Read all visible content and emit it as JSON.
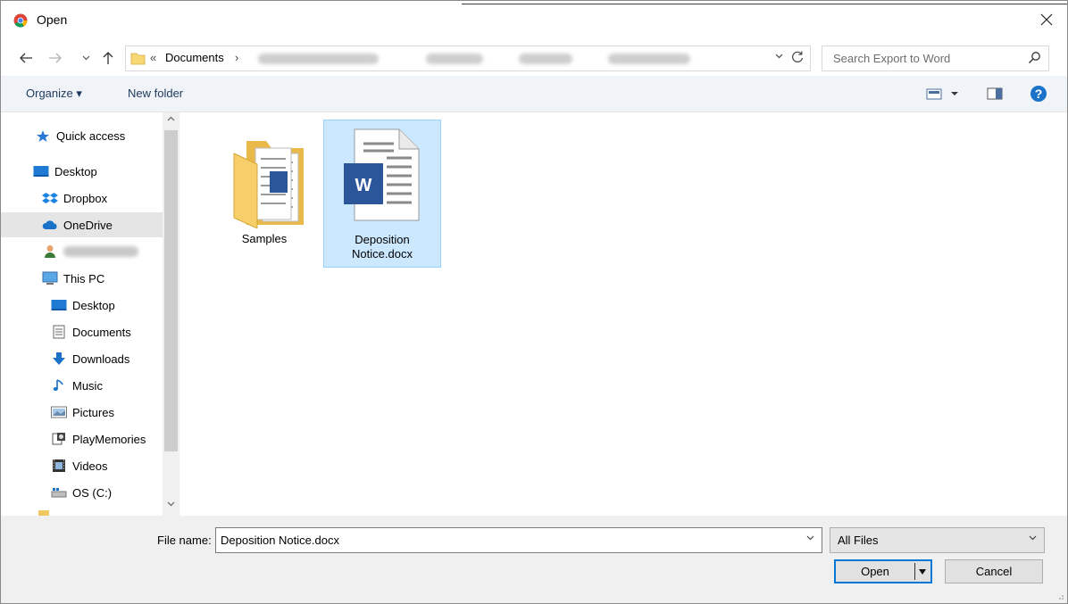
{
  "title_bar": {
    "title": "Open",
    "app_icon": "chrome-icon",
    "close_icon": "close-icon"
  },
  "navigation": {
    "back_icon": "back-arrow-icon",
    "forward_icon": "forward-arrow-icon",
    "recent_icon": "chevron-down-icon",
    "up_icon": "up-arrow-icon"
  },
  "address_bar": {
    "overflow": "«",
    "segments": [
      "Documents"
    ],
    "separator": "›"
  },
  "search": {
    "placeholder": "Search Export to Word"
  },
  "command_bar": {
    "organize": "Organize ▾",
    "new_folder": "New folder"
  },
  "nav_pane": {
    "quick_access": "Quick access",
    "desktop": "Desktop",
    "dropbox": "Dropbox",
    "onedrive": "OneDrive",
    "this_pc": "This PC",
    "pc_desktop": "Desktop",
    "documents": "Documents",
    "downloads": "Downloads",
    "music": "Music",
    "pictures": "Pictures",
    "playmemories": "PlayMemories",
    "videos": "Videos",
    "os_c": "OS (C:)",
    "selected": "OneDrive"
  },
  "files": [
    {
      "name": "Samples",
      "type": "folder"
    },
    {
      "name_line1": "Deposition",
      "name_line2": "Notice.docx",
      "type": "docx",
      "selected": true
    }
  ],
  "bottom": {
    "file_name_label": "File name:",
    "file_name_value": "Deposition Notice.docx",
    "filter_value": "All Files",
    "open_label": "Open",
    "cancel_label": "Cancel"
  },
  "colors": {
    "selection": "#cce8ff",
    "accent": "#0078d7",
    "word_blue": "#2b579a"
  }
}
